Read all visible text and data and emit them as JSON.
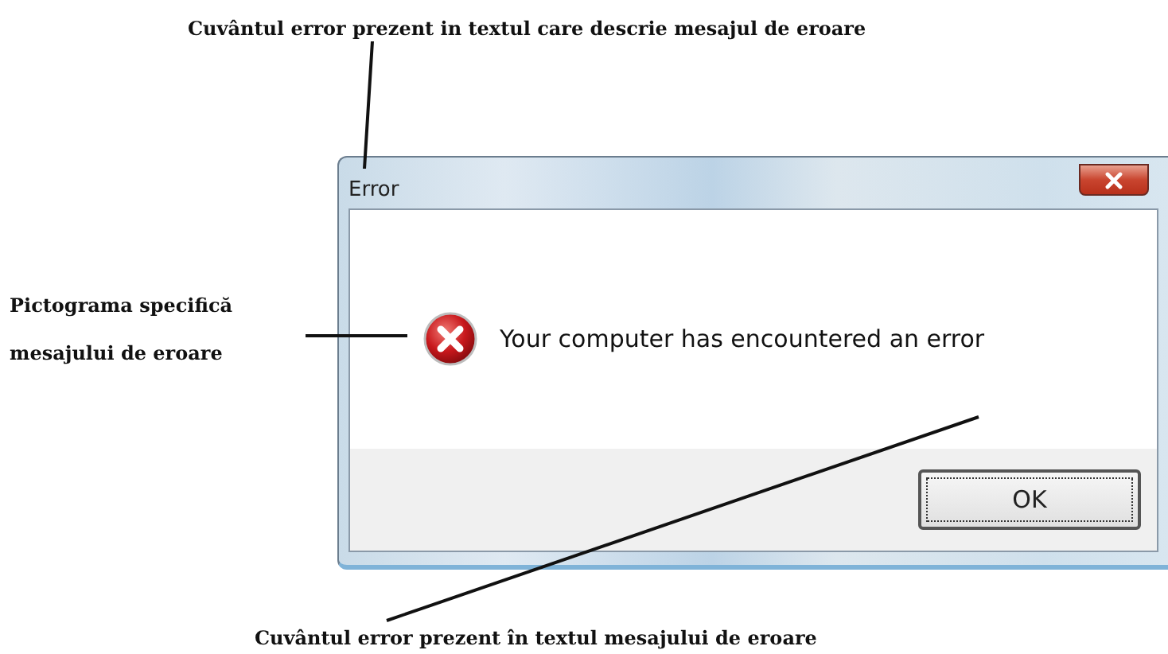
{
  "annotations": {
    "top": "Cuvântul error prezent in textul care descrie mesajul de eroare",
    "left": "Pictograma specifică mesajului de eroare",
    "bottom": "Cuvântul error prezent în textul mesajului de eroare"
  },
  "dialog": {
    "title": "Error",
    "message": "Your computer has encountered an error",
    "buttons": [
      "OK"
    ]
  }
}
